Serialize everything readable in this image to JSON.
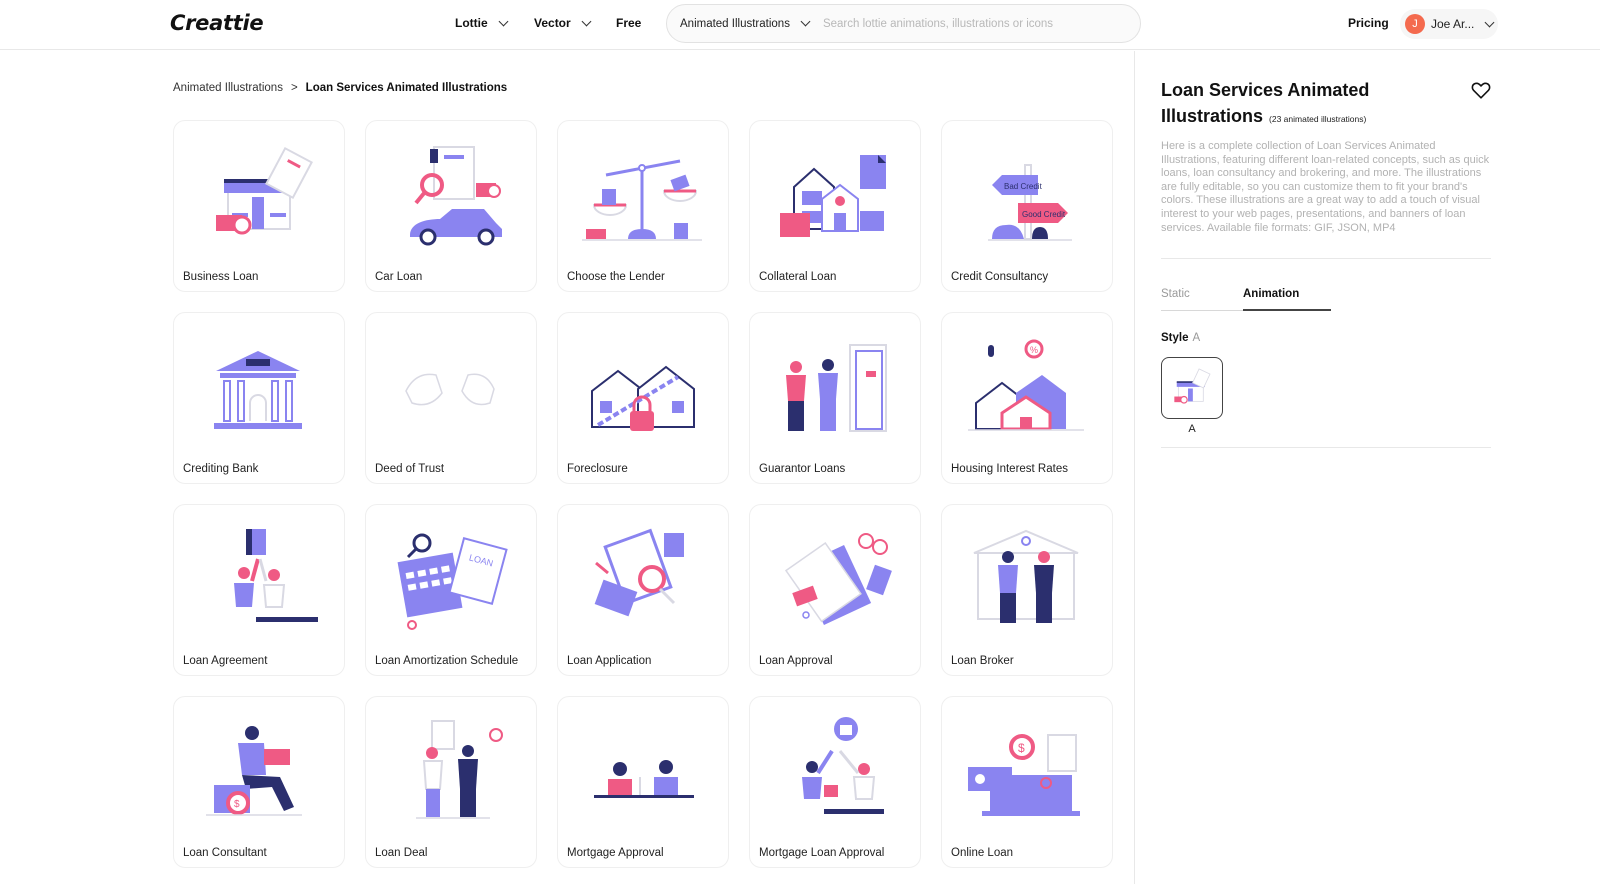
{
  "header": {
    "logo": "Creattie",
    "nav": [
      {
        "label": "Lottie",
        "has_dropdown": true
      },
      {
        "label": "Vector",
        "has_dropdown": true
      },
      {
        "label": "Free",
        "has_dropdown": false
      }
    ],
    "search": {
      "category": "Animated Illustrations",
      "placeholder": "Search lottie animations, illustrations or icons",
      "value": ""
    },
    "pricing": "Pricing",
    "user": {
      "initial": "J",
      "name": "Joe Ar...",
      "avatar_color": "#f46a4e"
    }
  },
  "breadcrumb": {
    "parent": "Animated Illustrations",
    "separator": ">",
    "current": "Loan Services Animated Illustrations"
  },
  "items": [
    {
      "label": "Business Loan",
      "icon": "storefront-loan"
    },
    {
      "label": "Car Loan",
      "icon": "car-document"
    },
    {
      "label": "Choose the Lender",
      "icon": "balance-scale"
    },
    {
      "label": "Collateral Loan",
      "icon": "house-coins"
    },
    {
      "label": "Credit Consultancy",
      "icon": "signpost-credit"
    },
    {
      "label": "Crediting Bank",
      "icon": "bank-building"
    },
    {
      "label": "Deed of Trust",
      "icon": "handshake-sketch"
    },
    {
      "label": "Foreclosure",
      "icon": "house-padlock"
    },
    {
      "label": "Guarantor Loans",
      "icon": "people-door"
    },
    {
      "label": "Housing Interest Rates",
      "icon": "houses-percent"
    },
    {
      "label": "Loan Agreement",
      "icon": "high-five-document"
    },
    {
      "label": "Loan Amortization Schedule",
      "icon": "calendar-loan"
    },
    {
      "label": "Loan Application",
      "icon": "clipboard-magnifier"
    },
    {
      "label": "Loan Approval",
      "icon": "document-glasses"
    },
    {
      "label": "Loan Broker",
      "icon": "broker-building"
    },
    {
      "label": "Loan Consultant",
      "icon": "person-laptop"
    },
    {
      "label": "Loan Deal",
      "icon": "handshake-people"
    },
    {
      "label": "Mortgage Approval",
      "icon": "meeting-table"
    },
    {
      "label": "Mortgage Loan Approval",
      "icon": "high-five-house"
    },
    {
      "label": "Online Loan",
      "icon": "laptop-money"
    }
  ],
  "sidebar": {
    "title": "Loan Services Animated Illustrations",
    "count": "(23 animated illustrations)",
    "description": "Here is a complete collection of Loan Services Animated Illustrations, featuring different loan-related concepts, such as quick loans, loan consultancy and brokering, and more. The illustrations are fully editable, so you can customize them to fit your brand's colors. These illustrations are a great way to add a touch of visual interest to your web pages, presentations, and banners of loan services. Available file formats: GIF, JSON, MP4",
    "tabs": [
      {
        "label": "Static",
        "active": false
      },
      {
        "label": "Animation",
        "active": true
      }
    ],
    "style_label": "Style",
    "style_value": "A",
    "style_options": [
      {
        "label": "A",
        "selected": true
      }
    ]
  },
  "colors": {
    "purple": "#8a84f0",
    "navy": "#2b2f6e",
    "pink": "#ef5a84",
    "line": "#d9d9e3"
  }
}
